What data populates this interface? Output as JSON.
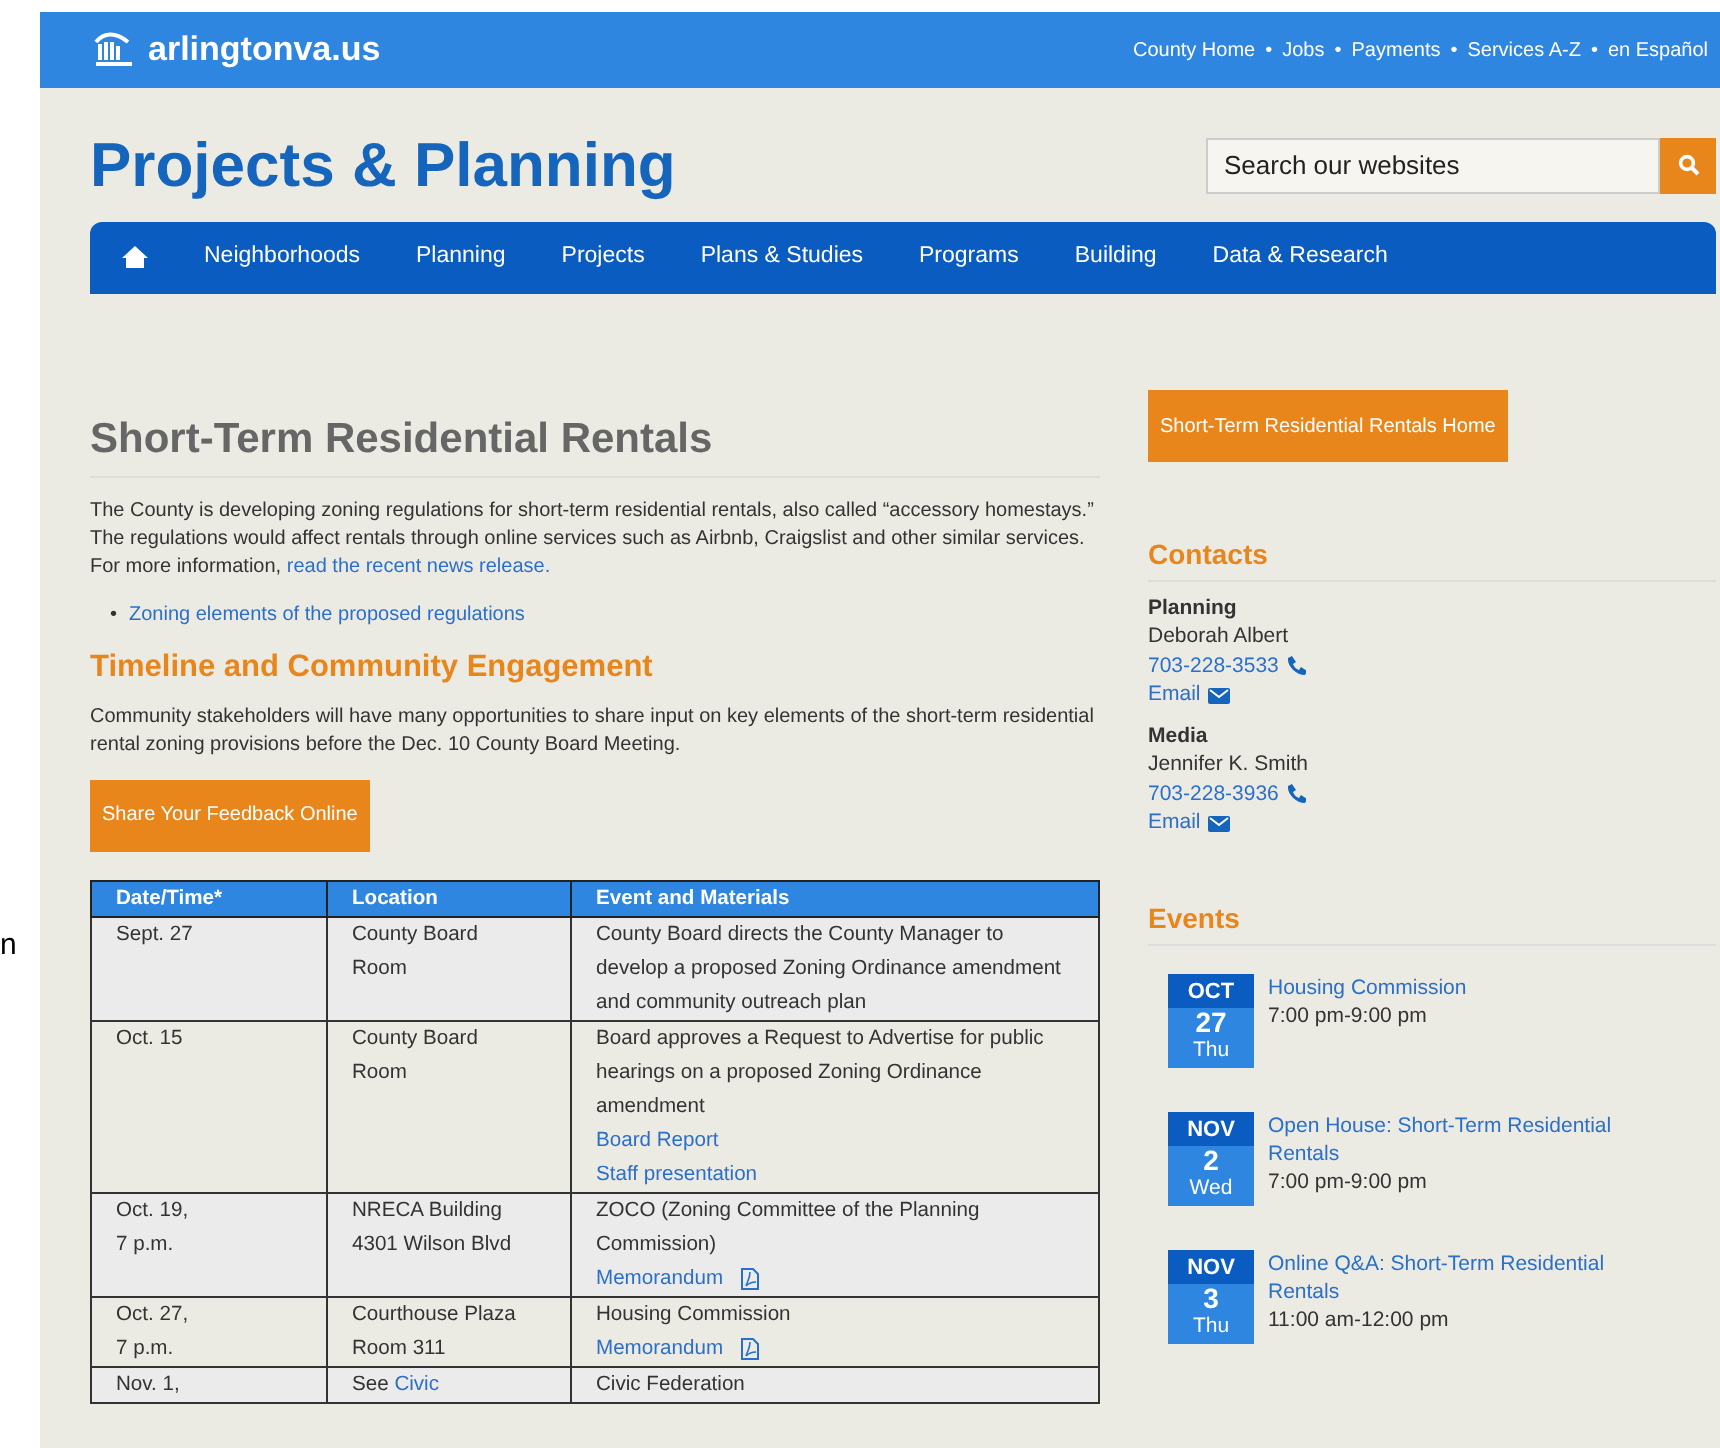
{
  "edge_fragment": "n",
  "top_bar": {
    "logo": "arlingtonva.us",
    "links": [
      "County Home",
      "Jobs",
      "Payments",
      "Services A-Z",
      "en Español"
    ],
    "separator": "•"
  },
  "header": {
    "title": "Projects & Planning",
    "search": {
      "placeholder": "Search our websites"
    }
  },
  "nav": {
    "items": [
      "Neighborhoods",
      "Planning",
      "Projects",
      "Plans & Studies",
      "Programs",
      "Building",
      "Data & Research"
    ]
  },
  "main": {
    "title": "Short-Term Residential Rentals",
    "intro": "The County is developing zoning regulations for short-term residential rentals, also called “accessory homestays.” The regulations would affect rentals through online services such as Airbnb, Craigslist and other similar services. For more information, ",
    "intro_link": "read the recent news release.",
    "bullet_mark": "•",
    "bullets": [
      "Zoning elements of the proposed regulations"
    ],
    "section_title": "Timeline and Community Engagement",
    "section_text": "Community stakeholders will have many opportunities to share input on key elements of the short-term residential rental zoning provisions before the Dec. 10 County Board Meeting.",
    "button": "Share Your Feedback Online",
    "table": {
      "columns": [
        "Date/Time*",
        "Location",
        "Event and Materials"
      ],
      "rows": [
        {
          "date": [
            "Sept. 27"
          ],
          "location": [
            [
              {
                "text": "County Board"
              }
            ],
            [
              {
                "text": "Room"
              }
            ]
          ],
          "event": "County Board directs the County Manager to develop a proposed Zoning Ordinance amendment and community outreach plan",
          "links": []
        },
        {
          "date": [
            "Oct. 15"
          ],
          "location": [
            [
              {
                "text": "County Board"
              }
            ],
            [
              {
                "text": "Room"
              }
            ]
          ],
          "event": "Board approves a Request to Advertise for public hearings on a proposed Zoning Ordinance amendment",
          "links": [
            {
              "text": "Board Report",
              "pdf": false
            },
            {
              "text": "Staff presentation",
              "pdf": false
            }
          ]
        },
        {
          "date": [
            "Oct. 19,",
            "7 p.m."
          ],
          "location": [
            [
              {
                "text": "NRECA Building"
              }
            ],
            [
              {
                "text": "4301 Wilson Blvd"
              }
            ]
          ],
          "event": "ZOCO (Zoning Committee of the Planning Commission)",
          "links": [
            {
              "text": "Memorandum",
              "pdf": true
            }
          ]
        },
        {
          "date": [
            "Oct. 27,",
            "7 p.m."
          ],
          "location": [
            [
              {
                "text": "Courthouse Plaza"
              }
            ],
            [
              {
                "text": "Room 311"
              }
            ]
          ],
          "event": "Housing Commission",
          "links": [
            {
              "text": "Memorandum",
              "pdf": true
            }
          ]
        },
        {
          "date": [
            "Nov. 1,"
          ],
          "location": [
            [
              {
                "text": "See "
              },
              {
                "text": "Civic",
                "link": true
              }
            ]
          ],
          "event": "Civic Federation",
          "links": []
        }
      ]
    }
  },
  "sidebar": {
    "button": "Short-Term Residential Rentals Home",
    "contacts_title": "Contacts",
    "contacts": [
      {
        "group": "Planning",
        "name": "Deborah Albert",
        "phone": "703-228-3533",
        "email": "Email"
      },
      {
        "group": "Media",
        "name": "Jennifer K. Smith",
        "phone": "703-228-3936",
        "email": "Email"
      }
    ],
    "events_title": "Events",
    "events": [
      {
        "month": "OCT",
        "day": "27",
        "weekday": "Thu",
        "title": "Housing Commission",
        "time": "7:00 pm-9:00 pm"
      },
      {
        "month": "NOV",
        "day": "2",
        "weekday": "Wed",
        "title": "Open House: Short-Term Residential Rentals",
        "time": "7:00 pm-9:00 pm"
      },
      {
        "month": "NOV",
        "day": "3",
        "weekday": "Thu",
        "title": "Online Q&A: Short-Term Residential Rentals",
        "time": "11:00 am-12:00 pm"
      }
    ]
  }
}
